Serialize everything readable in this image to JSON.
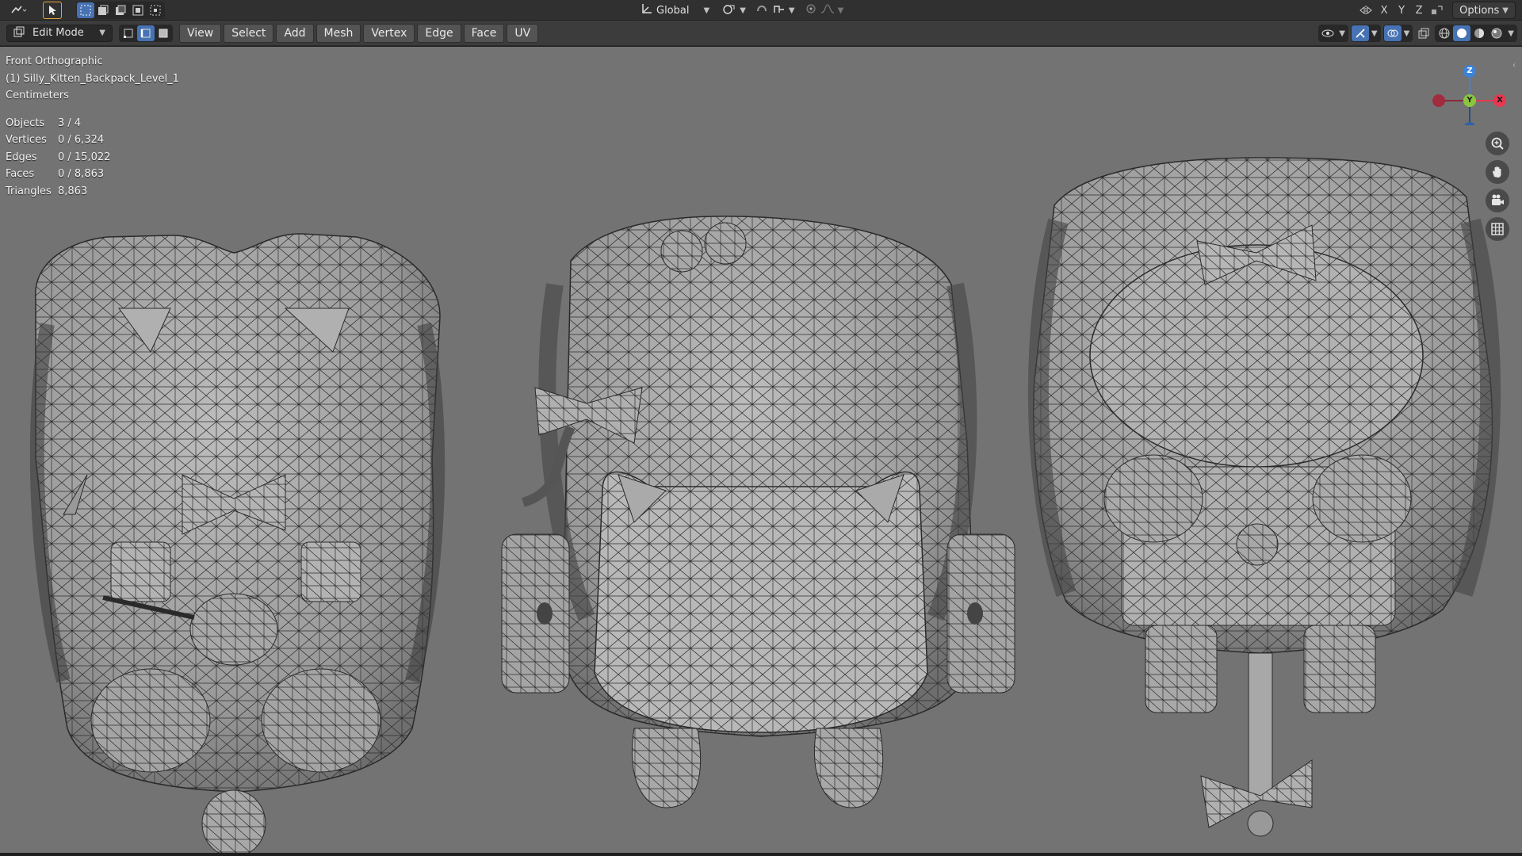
{
  "topbar": {
    "transform_orientation": "Global",
    "axis_x": "X",
    "axis_y": "Y",
    "axis_z": "Z",
    "options_label": "Options"
  },
  "header": {
    "mode": "Edit Mode",
    "menus": [
      "View",
      "Select",
      "Add",
      "Mesh",
      "Vertex",
      "Edge",
      "Face",
      "UV"
    ]
  },
  "overlay": {
    "view_name": "Front Orthographic",
    "object_name": "(1) Silly_Kitten_Backpack_Level_1",
    "units": "Centimeters",
    "stats": [
      {
        "label": "Objects",
        "value": "3 / 4"
      },
      {
        "label": "Vertices",
        "value": "0 / 6,324"
      },
      {
        "label": "Edges",
        "value": "0 / 15,022"
      },
      {
        "label": "Faces",
        "value": "0 / 8,863"
      },
      {
        "label": "Triangles",
        "value": "8,863"
      }
    ]
  },
  "gizmo": {
    "z": "Z",
    "y": "Y",
    "x": "X",
    "colors": {
      "x": "#e8384f",
      "y": "#8cc63f",
      "z": "#3b83d8"
    }
  },
  "icons": [
    "editor-type-icon",
    "select-cursor-icon",
    "select-box-icon",
    "snap-icon",
    "proportional-edit-icon",
    "zoom-icon",
    "pan-hand-icon",
    "camera-view-icon",
    "ortho-grid-icon",
    "overlay-icon",
    "shading-solid-icon"
  ]
}
